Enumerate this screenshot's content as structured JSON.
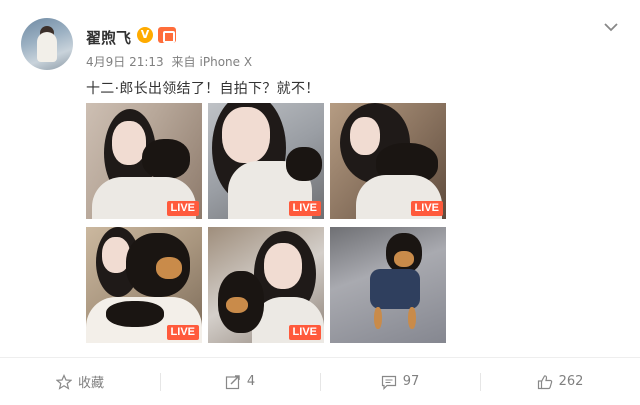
{
  "post": {
    "author": "翟煦飞",
    "date": "4月9日 21:13",
    "source_prefix": "来自",
    "device": "iPhone X",
    "text": "十二·郎长出领结了！自拍下？就不！"
  },
  "badges": {
    "verified_label": "V",
    "verified_color": "#ffab00",
    "vip_color": "#ff6d3a"
  },
  "photos": [
    {
      "live": "LIVE"
    },
    {
      "live": "LIVE"
    },
    {
      "live": "LIVE"
    },
    {
      "live": "LIVE"
    },
    {
      "live": "LIVE"
    },
    {
      "live": ""
    }
  ],
  "actions": {
    "favorite_label": "收藏",
    "repost_count": "4",
    "comment_count": "97",
    "like_count": "262"
  },
  "icons": {
    "menu": "chevron-down-icon",
    "favorite": "star-icon",
    "repost": "share-icon",
    "comment": "comment-icon",
    "like": "thumbs-up-icon"
  },
  "colors": {
    "live_badge": "#ff5a3c",
    "meta_text": "#808080"
  }
}
